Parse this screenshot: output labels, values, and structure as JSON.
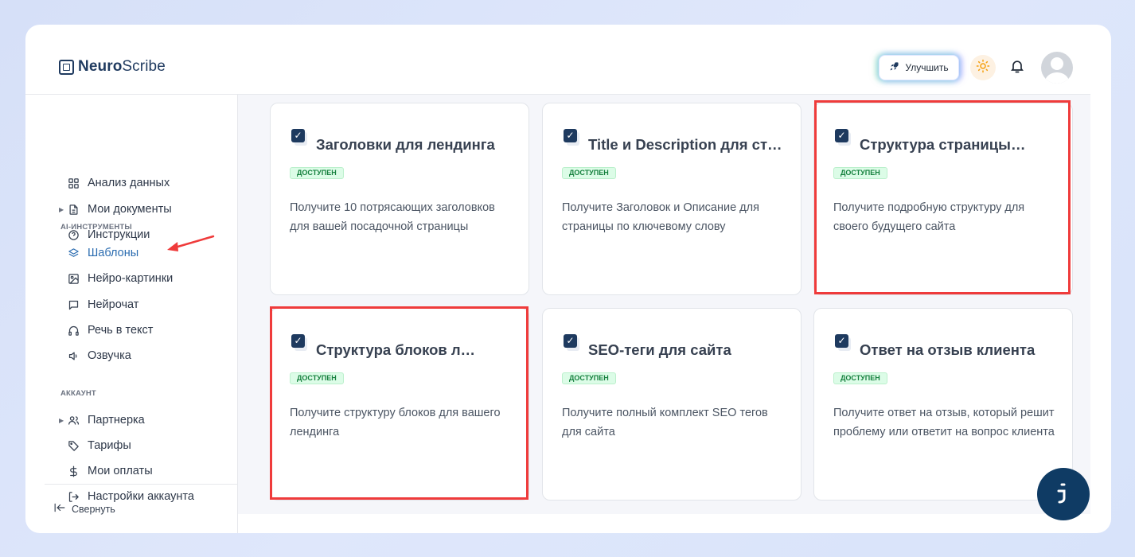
{
  "header": {
    "logo_bold": "Neuro",
    "logo_light": "Scribe",
    "upgrade_label": "Улучшить"
  },
  "icons": {
    "logo": "logo-icon",
    "upgrade": "rocket-icon",
    "theme": "sun-icon",
    "notifications": "bell-icon",
    "avatar": "user-avatar"
  },
  "sidebar": {
    "items_top": [
      {
        "label": "Анализ данных",
        "icon": "grid-icon"
      },
      {
        "label": "Мои документы",
        "icon": "document-icon",
        "expandable": true
      },
      {
        "label": "Инструкции",
        "icon": "help-circle-icon"
      }
    ],
    "section_ai": "AI-ИНСТРУМЕНТЫ",
    "items_ai": [
      {
        "label": "Шаблоны",
        "icon": "layers-icon",
        "active": true
      },
      {
        "label": "Нейро-картинки",
        "icon": "image-icon"
      },
      {
        "label": "Нейрочат",
        "icon": "chat-icon"
      },
      {
        "label": "Речь в текст",
        "icon": "headphones-icon"
      },
      {
        "label": "Озвучка",
        "icon": "speaker-icon"
      }
    ],
    "section_account": "АККАУНТ",
    "items_account": [
      {
        "label": "Партнерка",
        "icon": "users-icon",
        "expandable": true
      },
      {
        "label": "Тарифы",
        "icon": "tag-icon"
      },
      {
        "label": "Мои оплаты",
        "icon": "dollar-icon"
      },
      {
        "label": "Настройки аккаунта",
        "icon": "logout-icon"
      }
    ],
    "collapse_label": "Свернуть"
  },
  "cards": [
    {
      "title": "Заголовки для лендинга",
      "badge": "ДОСТУПЕН",
      "description": "Получите 10 потрясающих заголовков для вашей посадочной страницы",
      "highlighted": false
    },
    {
      "title": "Title и Description для страницы",
      "badge": "ДОСТУПЕН",
      "description": "Получите Заголовок и Описание для страницы по ключевому слову",
      "highlighted": false
    },
    {
      "title": "Структура страницы сайта",
      "badge": "ДОСТУПЕН",
      "description": "Получите подробную структуру для своего будущего сайта",
      "highlighted": true
    },
    {
      "title": "Структура блоков лендинга",
      "badge": "ДОСТУПЕН",
      "description": "Получите структуру блоков для вашего лендинга",
      "highlighted": true
    },
    {
      "title": "SEO-теги для сайта",
      "badge": "ДОСТУПЕН",
      "description": "Получите полный комплект SEO тегов для сайта",
      "highlighted": false
    },
    {
      "title": "Ответ на отзыв клиента",
      "badge": "ДОСТУПЕН",
      "description": "Получите ответ на отзыв, который решит проблему или ответит на вопрос клиента",
      "highlighted": false
    }
  ],
  "colors": {
    "accent": "#2b6cb0",
    "brand_dark": "#1e3a5f",
    "badge_green": "#15803d",
    "highlight_red": "#ef3b3b",
    "chat_fab": "#0f3b64"
  }
}
